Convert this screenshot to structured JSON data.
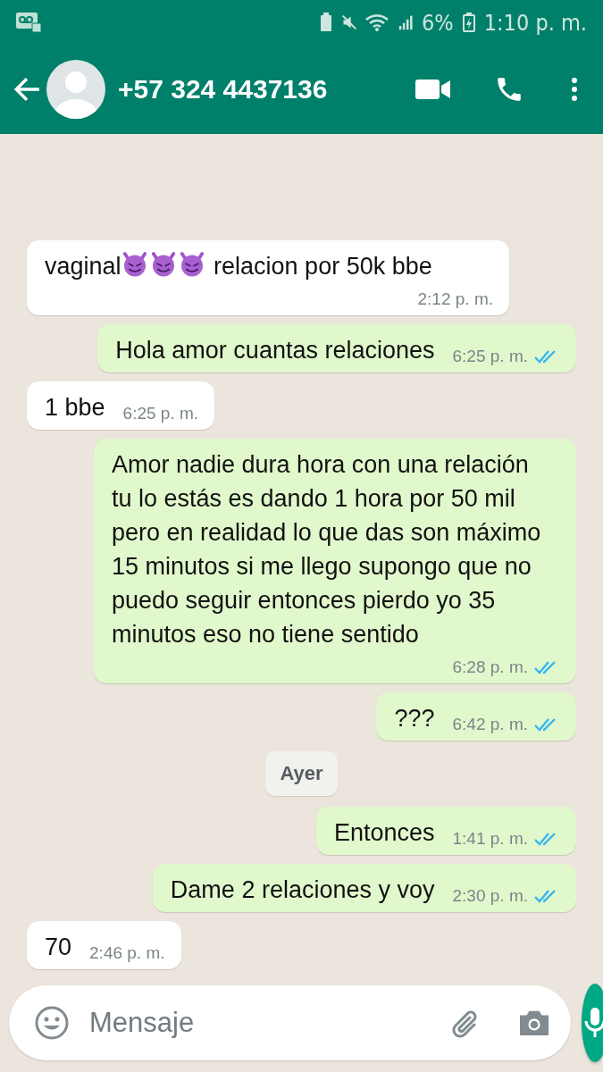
{
  "status_bar": {
    "battery": "6%",
    "time": "1:10 p. m."
  },
  "header": {
    "contact": "+57 324 4437136"
  },
  "messages": [
    {
      "kind": "in",
      "segments": [
        {
          "kind": "text",
          "text": "vaginal"
        },
        {
          "kind": "emoji"
        },
        {
          "kind": "emoji"
        },
        {
          "kind": "emoji"
        },
        {
          "kind": "text",
          "text": " relacion por 50k bbe"
        }
      ],
      "time": "2:12 p. m."
    },
    {
      "kind": "out",
      "segments": [
        {
          "kind": "text",
          "text": "Hola amor cuantas relaciones"
        }
      ],
      "time": "6:25 p. m.",
      "read": true
    },
    {
      "kind": "in",
      "segments": [
        {
          "kind": "text",
          "text": "1 bbe"
        }
      ],
      "time": "6:25 p. m."
    },
    {
      "kind": "out",
      "segments": [
        {
          "kind": "text",
          "text": "Amor nadie dura hora con una relación tu lo estás es dando 1 hora por 50 mil pero en realidad lo que das son máximo 15 minutos si me llego supongo que no puedo seguir entonces pierdo yo 35 minutos eso no tiene sentido"
        }
      ],
      "time": "6:28 p. m.",
      "read": true
    },
    {
      "kind": "out",
      "segments": [
        {
          "kind": "text",
          "text": "???"
        }
      ],
      "time": "6:42 p. m.",
      "read": true
    },
    {
      "kind": "date",
      "text": "Ayer"
    },
    {
      "kind": "out",
      "segments": [
        {
          "kind": "text",
          "text": "Entonces"
        }
      ],
      "time": "1:41 p. m.",
      "read": true
    },
    {
      "kind": "out",
      "segments": [
        {
          "kind": "text",
          "text": "Dame 2 relaciones y  voy"
        }
      ],
      "time": "2:30 p. m.",
      "read": true
    },
    {
      "kind": "in",
      "segments": [
        {
          "kind": "text",
          "text": "70"
        }
      ],
      "time": "2:46 p. m."
    }
  ],
  "composer": {
    "placeholder": "Mensaje"
  }
}
